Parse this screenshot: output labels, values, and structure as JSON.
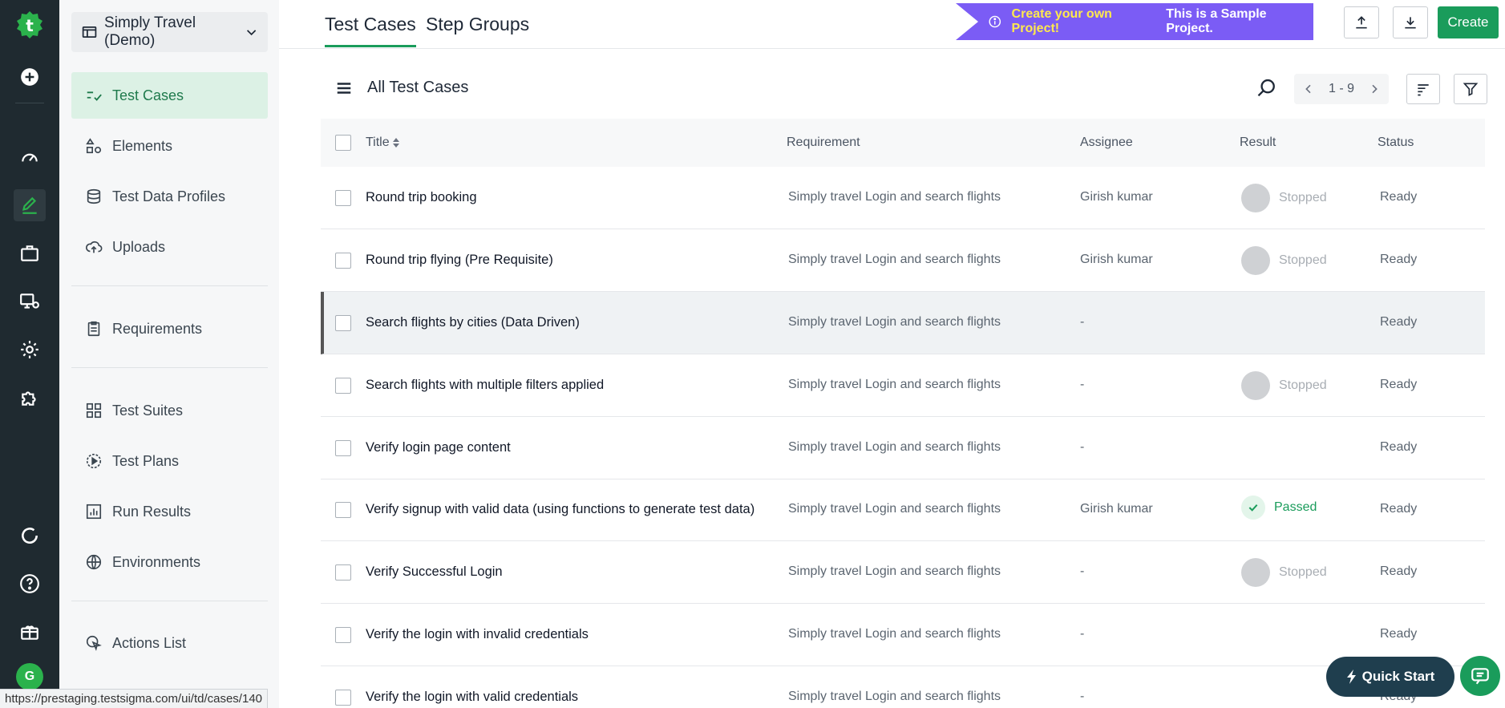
{
  "colors": {
    "brand_green": "#1a9c5b",
    "rail_bg": "#1f2a30",
    "banner_purple": "#7b5cf5",
    "banner_yellow": "#ffe94d"
  },
  "rail": {
    "icons": [
      "testsigma-logo-icon",
      "add-circle-icon",
      "dashboard-icon",
      "edit-icon",
      "briefcase-icon",
      "monitor-settings-icon",
      "gear-icon",
      "puzzle-icon",
      "refresh-icon",
      "help-icon",
      "gift-icon"
    ],
    "avatar_initial": "G"
  },
  "nav": {
    "project": "Simply Travel (Demo)",
    "items": [
      {
        "label": "Test Cases",
        "icon": "test-cases-icon",
        "active": true
      },
      {
        "label": "Elements",
        "icon": "elements-icon"
      },
      {
        "label": "Test Data Profiles",
        "icon": "database-icon"
      },
      {
        "label": "Uploads",
        "icon": "cloud-upload-icon"
      },
      {
        "label": "Requirements",
        "icon": "clipboard-icon"
      },
      {
        "label": "Test Suites",
        "icon": "grid-icon"
      },
      {
        "label": "Test Plans",
        "icon": "play-circle-icon"
      },
      {
        "label": "Run Results",
        "icon": "bar-chart-icon"
      },
      {
        "label": "Environments",
        "icon": "globe-icon"
      },
      {
        "label": "Actions List",
        "icon": "cursor-click-icon"
      }
    ]
  },
  "header": {
    "tabs": [
      {
        "label": "Test Cases",
        "active": true
      },
      {
        "label": "Step Groups"
      }
    ],
    "banner_highlight": "Create your own Project!",
    "banner_text": "This is a Sample Project.",
    "create_label": "Create"
  },
  "list": {
    "title": "All Test Cases",
    "pager": "1 - 9",
    "columns": {
      "title": "Title",
      "requirement": "Requirement",
      "assignee": "Assignee",
      "result": "Result",
      "status": "Status"
    },
    "rows": [
      {
        "title": "Round trip booking",
        "requirement": "Simply travel Login and search flights",
        "assignee": "Girish kumar",
        "result": "Stopped",
        "status": "Ready"
      },
      {
        "title": "Round trip flying (Pre Requisite)",
        "requirement": "Simply travel Login and search flights",
        "assignee": "Girish kumar",
        "result": "Stopped",
        "status": "Ready"
      },
      {
        "title": "Search flights by cities (Data Driven)",
        "requirement": "Simply travel Login and search flights",
        "assignee": "-",
        "result": "",
        "status": "Ready"
      },
      {
        "title": "Search flights with multiple filters applied",
        "requirement": "Simply travel Login and search flights",
        "assignee": "-",
        "result": "Stopped",
        "status": "Ready"
      },
      {
        "title": "Verify login page content",
        "requirement": "Simply travel Login and search flights",
        "assignee": "-",
        "result": "",
        "status": "Ready"
      },
      {
        "title": "Verify signup with valid data (using functions to generate test data)",
        "requirement": "Simply travel Login and search flights",
        "assignee": "Girish kumar",
        "result": "Passed",
        "status": "Ready"
      },
      {
        "title": "Verify Successful Login",
        "requirement": "Simply travel Login and search flights",
        "assignee": "-",
        "result": "Stopped",
        "status": "Ready"
      },
      {
        "title": "Verify the login with invalid credentials",
        "requirement": "Simply travel Login and search flights",
        "assignee": "-",
        "result": "",
        "status": "Ready"
      },
      {
        "title": "Verify the login with valid credentials",
        "requirement": "Simply travel Login and search flights",
        "assignee": "-",
        "result": "",
        "status": "Ready"
      }
    ]
  },
  "quick_start_label": "Quick Start",
  "status_url": "https://prestaging.testsigma.com/ui/td/cases/140"
}
